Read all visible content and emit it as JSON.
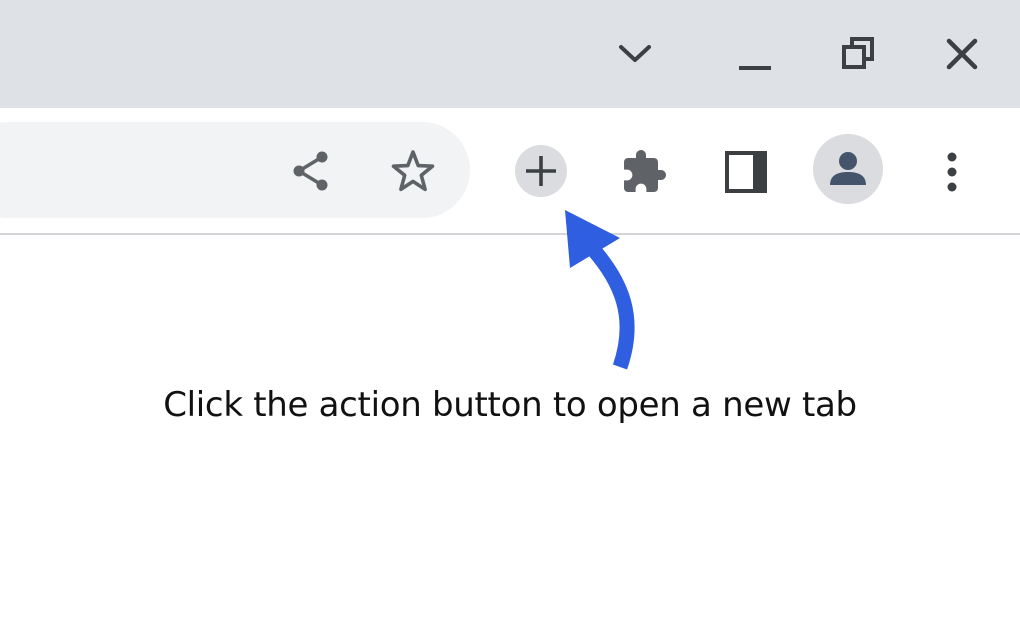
{
  "titlebar": {
    "tab_search": {
      "icon": "chevron-down-icon"
    },
    "minimize": {
      "icon": "minimize-icon"
    },
    "restore": {
      "icon": "restore-icon"
    },
    "close": {
      "icon": "close-icon"
    }
  },
  "toolbar": {
    "share": {
      "icon": "share-icon"
    },
    "bookmark": {
      "icon": "star-icon"
    },
    "action": {
      "icon": "plus-icon"
    },
    "extensions": {
      "icon": "puzzle-icon"
    },
    "side_panel": {
      "icon": "side-panel-icon"
    },
    "profile": {
      "icon": "person-icon"
    },
    "menu": {
      "icon": "kebab-menu-icon"
    }
  },
  "content": {
    "instruction": "Click the action button to open a new tab"
  },
  "colors": {
    "titlebar_bg": "#dee1e6",
    "toolbar_bg": "#ffffff",
    "omnibox_bg": "#f1f3f4",
    "icon": "#5f6368",
    "window_controls": "#3c4043",
    "arrow_accent": "#2f5fe0",
    "avatar_bg": "#dadce0",
    "avatar_icon": "#44546a"
  }
}
